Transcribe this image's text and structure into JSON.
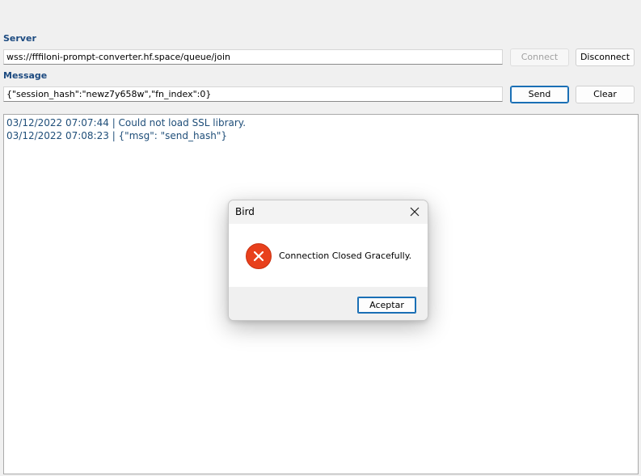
{
  "server": {
    "label": "Server",
    "value": "wss://fffiloni-prompt-converter.hf.space/queue/join",
    "connect_label": "Connect",
    "disconnect_label": "Disconnect"
  },
  "message": {
    "label": "Message",
    "value": "{\"session_hash\":\"newz7y658w\",\"fn_index\":0}",
    "send_label": "Send",
    "clear_label": "Clear"
  },
  "log": {
    "lines": [
      "03/12/2022 07:07:44 | Could not load SSL library.",
      "03/12/2022 07:08:23 | {\"msg\": \"send_hash\"}"
    ]
  },
  "dialog": {
    "title": "Bird",
    "message": "Connection Closed Gracefully.",
    "ok_label": "Aceptar",
    "icon": "error-icon",
    "icon_color": "#e8401c"
  },
  "colors": {
    "label_text": "#1c4a80",
    "log_text": "#1f4e79",
    "accent_border": "#1a6fb5"
  }
}
